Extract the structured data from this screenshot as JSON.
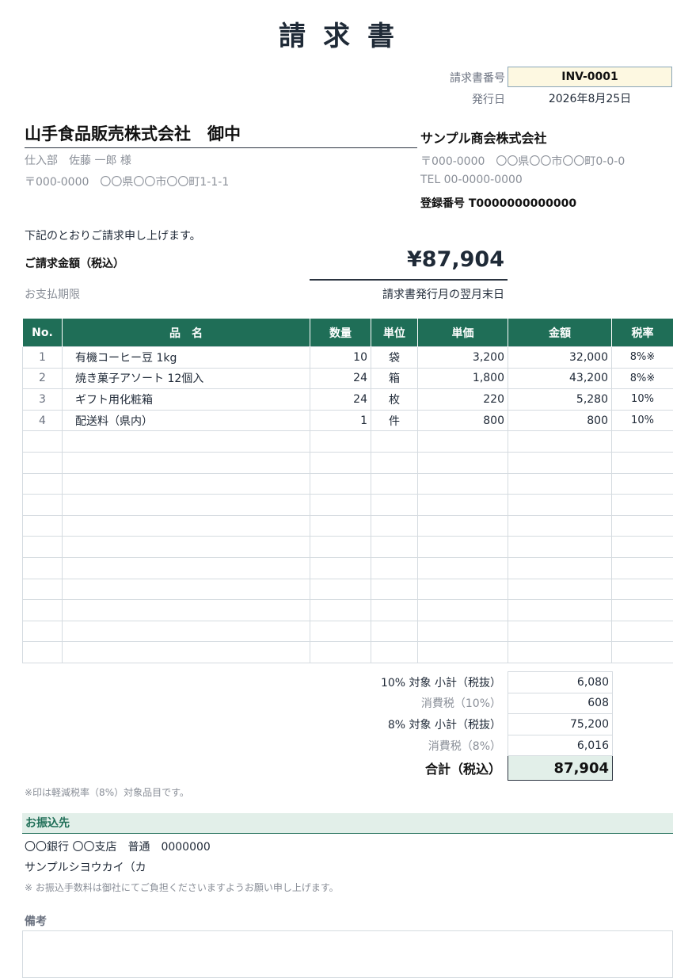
{
  "title": "請求書",
  "meta": {
    "invoice_no_label": "請求書番号",
    "invoice_no": "INV-0001",
    "issue_date_label": "発行日",
    "issue_date": "2026年8月25日"
  },
  "client": {
    "name": "山手食品販売株式会社　御中",
    "contact": "仕入部　佐藤 一郎 様",
    "address": "〒000-0000　〇〇県〇〇市〇〇町1-1-1"
  },
  "issuer": {
    "name": "サンプル商会株式会社",
    "address": "〒000-0000　〇〇県〇〇市〇〇町0-0-0",
    "tel": "TEL 00-0000-0000",
    "registration": "登録番号 T0000000000000"
  },
  "intro": "下記のとおりご請求申し上げます。",
  "billing": {
    "amount_label": "ご請求金額（税込）",
    "amount": "¥87,904",
    "due_label": "お支払期限",
    "due_value": "請求書発行月の翌月末日"
  },
  "table": {
    "headers": [
      "No.",
      "品　名",
      "数量",
      "単位",
      "単価",
      "金額",
      "税率"
    ],
    "rows": [
      {
        "no": "1",
        "name": "有機コーヒー豆 1kg",
        "qty": "10",
        "unit": "袋",
        "price": "3,200",
        "amount": "32,000",
        "tax": "8%※"
      },
      {
        "no": "2",
        "name": "焼き菓子アソート 12個入",
        "qty": "24",
        "unit": "箱",
        "price": "1,800",
        "amount": "43,200",
        "tax": "8%※"
      },
      {
        "no": "3",
        "name": "ギフト用化粧箱",
        "qty": "24",
        "unit": "枚",
        "price": "220",
        "amount": "5,280",
        "tax": "10%"
      },
      {
        "no": "4",
        "name": "配送料（県内）",
        "qty": "1",
        "unit": "件",
        "price": "800",
        "amount": "800",
        "tax": "10%"
      }
    ]
  },
  "summary": {
    "sub10_label": "10% 対象 小計（税抜）",
    "sub10": "6,080",
    "tax10_label": "消費税（10%）",
    "tax10": "608",
    "sub8_label": "8% 対象 小計（税抜）",
    "sub8": "75,200",
    "tax8_label": "消費税（8%）",
    "tax8": "6,016",
    "total_label": "合計（税込）",
    "total": "87,904"
  },
  "reduced_note": "※印は軽減税率（8%）対象品目です。",
  "bank": {
    "heading": "お振込先",
    "line1": "〇〇銀行 〇〇支店　普通　0000000",
    "line2": "サンプルシヨウカイ（カ",
    "note": "※ お振込手数料は御社にてご負担くださいますようお願い申し上げます。"
  },
  "remarks_label": "備考"
}
